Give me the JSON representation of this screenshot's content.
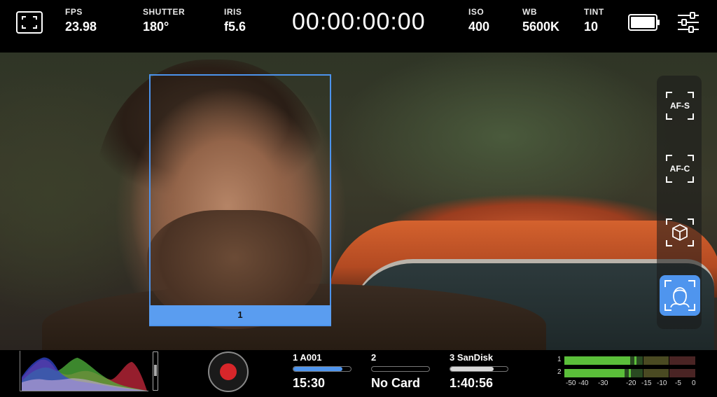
{
  "top_bar": {
    "fps": {
      "label": "FPS",
      "value": "23.98"
    },
    "shutter": {
      "label": "SHUTTER",
      "value": "180°"
    },
    "iris": {
      "label": "IRIS",
      "value": "f5.6"
    },
    "timecode": "00:00:00:00",
    "iso": {
      "label": "ISO",
      "value": "400"
    },
    "wb": {
      "label": "WB",
      "value": "5600K"
    },
    "tint": {
      "label": "TINT",
      "value": "10"
    },
    "icons": [
      "fullscreen-icon",
      "battery-icon",
      "settings-sliders-icon"
    ]
  },
  "viewfinder": {
    "face_tracking_box_label": "1"
  },
  "focus_panel": {
    "buttons": [
      {
        "label": "AF-S",
        "icon": "af-s-icon",
        "active": false
      },
      {
        "label": "AF-C",
        "icon": "af-c-icon",
        "active": false
      },
      {
        "label": "",
        "icon": "object-tracking-cube-icon",
        "active": false
      },
      {
        "label": "",
        "icon": "face-detection-icon",
        "active": true
      }
    ]
  },
  "bottom_bar": {
    "record_button_icon": "record-icon",
    "slots": [
      {
        "label": "1  A001",
        "value": "15:30",
        "fill": 0.85,
        "fill_color": "#4f95ee"
      },
      {
        "label": "2",
        "value": "No Card",
        "fill": 0.0,
        "fill_color": "#555555"
      },
      {
        "label": "3  SanDisk",
        "value": "1:40:56",
        "fill": 0.75,
        "fill_color": "#d8d8d8"
      }
    ],
    "audio": {
      "channels": [
        "1",
        "2"
      ],
      "scale": [
        "-50",
        "-40",
        "-30",
        "-20",
        "-15",
        "-10",
        "-5",
        "0"
      ],
      "levels_db": [
        -25,
        -27
      ]
    }
  },
  "colors": {
    "accent_blue": "#4f95ee",
    "record_red": "#d7262a",
    "meter_green": "#5bbf3a"
  }
}
